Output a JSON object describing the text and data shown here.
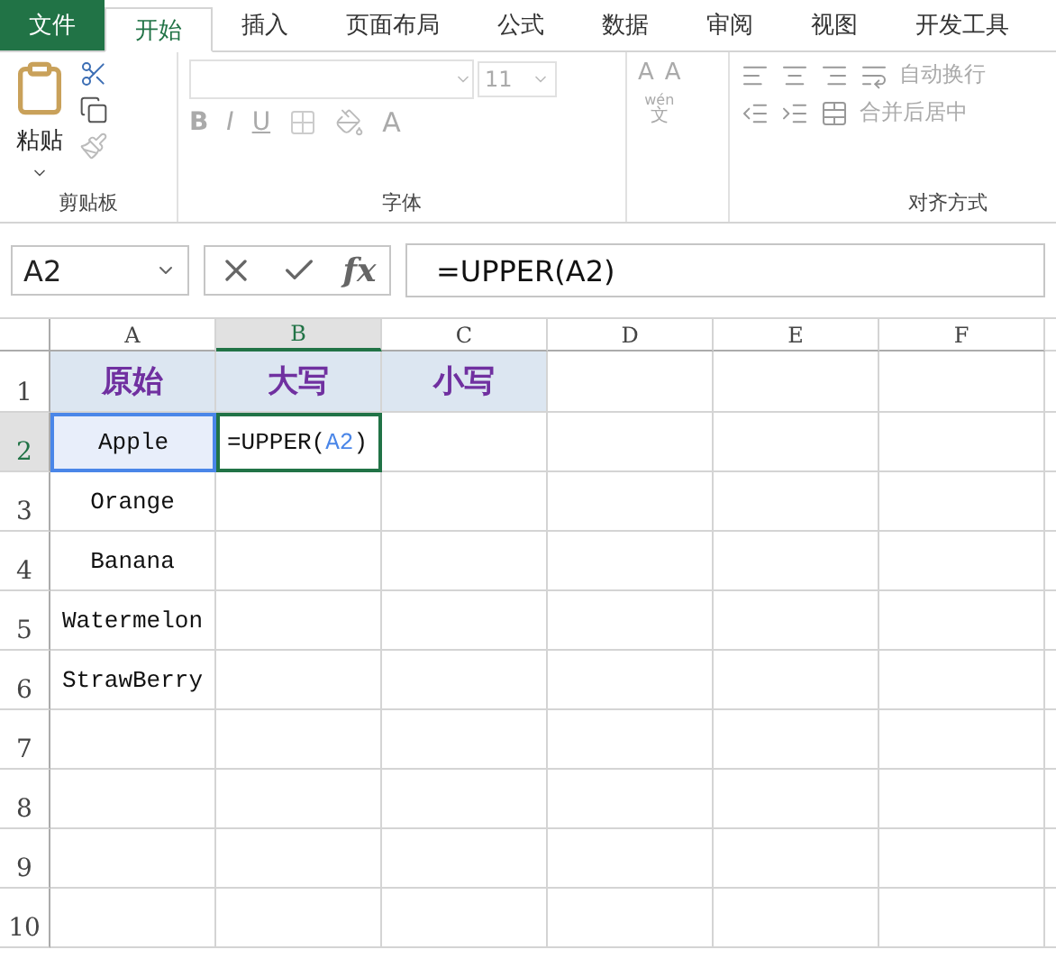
{
  "menu_tabs": [
    {
      "label": "文件",
      "kind": "file",
      "selected": false
    },
    {
      "label": "开始",
      "kind": "tab",
      "selected": true
    },
    {
      "label": "插入",
      "kind": "tab",
      "selected": false
    },
    {
      "label": "页面布局",
      "kind": "tab",
      "selected": false
    },
    {
      "label": "公式",
      "kind": "tab",
      "selected": false
    },
    {
      "label": "数据",
      "kind": "tab",
      "selected": false
    },
    {
      "label": "审阅",
      "kind": "tab",
      "selected": false
    },
    {
      "label": "视图",
      "kind": "tab",
      "selected": false
    },
    {
      "label": "开发工具",
      "kind": "tab",
      "selected": false
    }
  ],
  "ribbon": {
    "clipboard": {
      "paste_label": "粘贴",
      "group_label": "剪贴板"
    },
    "font": {
      "size": "11",
      "style_buttons": [
        "B",
        "I",
        "U"
      ],
      "color_button": "A",
      "grow_labels": [
        "A",
        "A"
      ],
      "phonetic": [
        "wén",
        "文"
      ],
      "group_label": "字体"
    },
    "alignment": {
      "wrap_label": "自动换行",
      "merge_label": "合并后居中",
      "group_label": "对齐方式"
    }
  },
  "name_box": {
    "value": "A2"
  },
  "formula_bar": {
    "function_label": "fx",
    "value": "=UPPER(A2)"
  },
  "sheet": {
    "columns": [
      {
        "label": "A",
        "selected": false
      },
      {
        "label": "B",
        "selected": true
      },
      {
        "label": "C",
        "selected": false
      },
      {
        "label": "D",
        "selected": false
      },
      {
        "label": "E",
        "selected": false
      },
      {
        "label": "F",
        "selected": false
      }
    ],
    "rows": [
      {
        "label": "1",
        "selected": false,
        "cells": [
          {
            "kind": "header",
            "text": "原始"
          },
          {
            "kind": "header",
            "text": "大写"
          },
          {
            "kind": "header",
            "text": "小写"
          }
        ]
      },
      {
        "label": "2",
        "selected": true,
        "cells": [
          {
            "kind": "text",
            "text": "Apple",
            "selected": true
          },
          {
            "kind": "formula",
            "parts": [
              {
                "text": "=UPPER(",
                "ref": false
              },
              {
                "text": "A2",
                "ref": true
              },
              {
                "text": ")",
                "ref": false
              }
            ],
            "active": true
          }
        ]
      },
      {
        "label": "3",
        "selected": false,
        "cells": [
          {
            "kind": "text",
            "text": "Orange",
            "selected": false
          }
        ]
      },
      {
        "label": "4",
        "selected": false,
        "cells": [
          {
            "kind": "text",
            "text": "Banana",
            "selected": false
          }
        ]
      },
      {
        "label": "5",
        "selected": false,
        "cells": [
          {
            "kind": "text",
            "text": "Watermelon",
            "selected": false
          }
        ]
      },
      {
        "label": "6",
        "selected": false,
        "cells": [
          {
            "kind": "text",
            "text": "StrawBerry",
            "selected": false
          }
        ]
      },
      {
        "label": "7",
        "selected": false,
        "cells": []
      },
      {
        "label": "8",
        "selected": false,
        "cells": []
      },
      {
        "label": "9",
        "selected": false,
        "cells": []
      },
      {
        "label": "10",
        "selected": false,
        "cells": []
      }
    ]
  }
}
